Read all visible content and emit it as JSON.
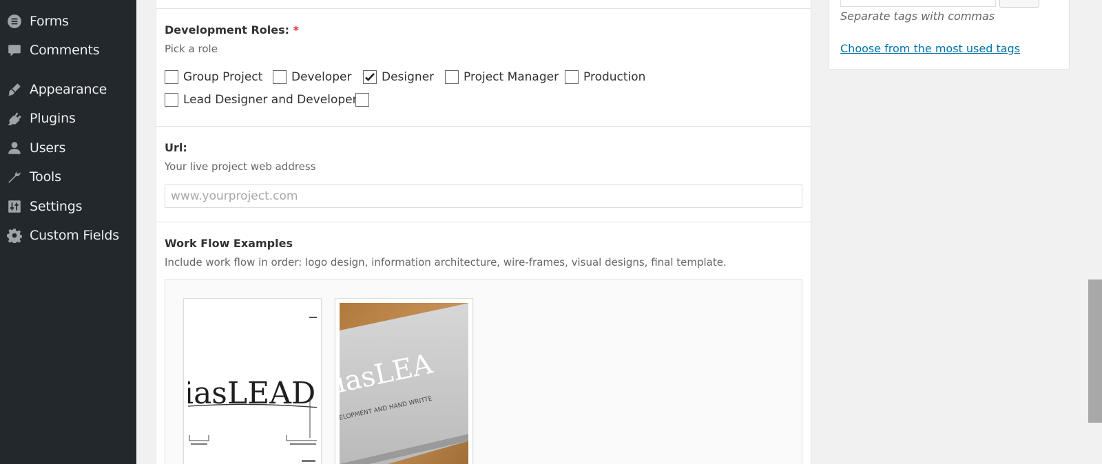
{
  "sidebar": {
    "items": [
      {
        "label": "Forms",
        "icon": "forms-icon"
      },
      {
        "label": "Comments",
        "icon": "comments-icon"
      },
      {
        "label": "Appearance",
        "icon": "appearance-icon"
      },
      {
        "label": "Plugins",
        "icon": "plugins-icon"
      },
      {
        "label": "Users",
        "icon": "users-icon"
      },
      {
        "label": "Tools",
        "icon": "tools-icon"
      },
      {
        "label": "Settings",
        "icon": "settings-icon"
      },
      {
        "label": "Custom Fields",
        "icon": "custom-fields-icon"
      }
    ]
  },
  "roles": {
    "label": "Development Roles:",
    "required_mark": "*",
    "description": "Pick a role",
    "options": [
      {
        "label": "Group Project",
        "checked": false
      },
      {
        "label": "Developer",
        "checked": false
      },
      {
        "label": "Designer",
        "checked": true
      },
      {
        "label": "Project Manager",
        "checked": false
      },
      {
        "label": "Production",
        "checked": false
      },
      {
        "label": "Lead Designer and Developer",
        "checked": false
      },
      {
        "label": "",
        "checked": false
      }
    ]
  },
  "url": {
    "label": "Url:",
    "description": "Your live project web address",
    "placeholder": "www.yourproject.com",
    "value": ""
  },
  "workflow": {
    "label": "Work Flow Examples",
    "description": "Include work flow in order: logo design, information architecture, wire-frames, visual designs, final template.",
    "thumbnails": [
      {
        "alt": "logo design sheet",
        "text": "iasLEAD"
      },
      {
        "alt": "business card photo",
        "text": "iasLEA",
        "subtext": "ELOPMENT AND HAND WRITTE"
      }
    ]
  },
  "tags": {
    "hint": "Separate tags with commas",
    "link": "Choose from the most used tags"
  },
  "colors": {
    "sidebar_bg": "#23282d",
    "link": "#0073aa",
    "required": "#dc3232"
  }
}
